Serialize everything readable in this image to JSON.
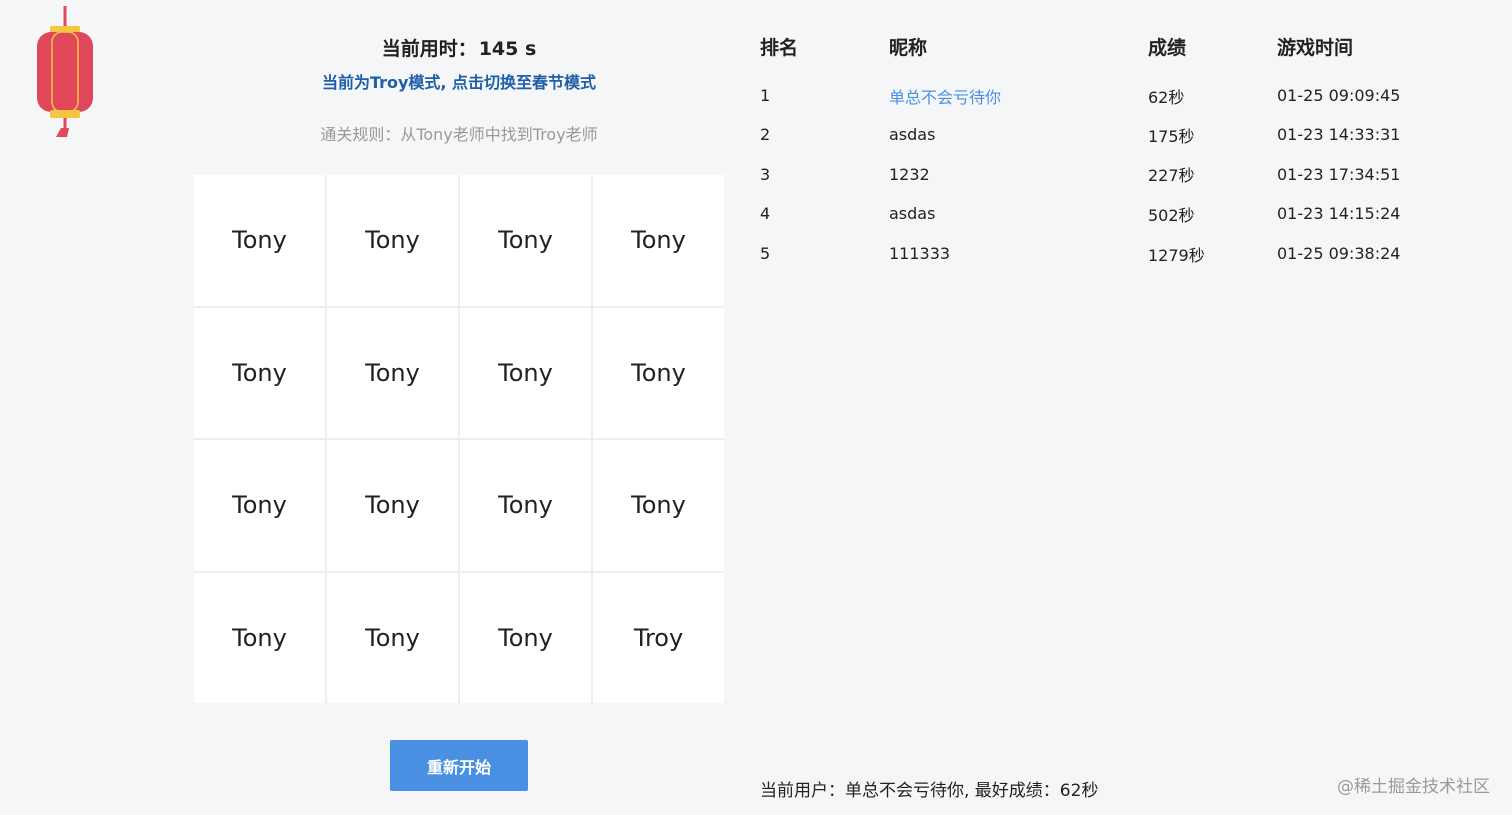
{
  "game": {
    "timer_label": "当前用时：",
    "timer_value": "145 s",
    "mode_switch": "当前为Troy模式, 点击切换至春节模式",
    "rules": "通关规则：从Tony老师中找到Troy老师",
    "cells": [
      "Tony",
      "Tony",
      "Tony",
      "Tony",
      "Tony",
      "Tony",
      "Tony",
      "Tony",
      "Tony",
      "Tony",
      "Tony",
      "Tony",
      "Tony",
      "Tony",
      "Tony",
      "Troy"
    ],
    "restart_label": "重新开始"
  },
  "leaderboard": {
    "headers": [
      "排名",
      "昵称",
      "成绩",
      "游戏时间"
    ],
    "rows": [
      {
        "rank": "1",
        "nickname": "单总不会亏待你",
        "score": "62秒",
        "time": "01-25 09:09:45"
      },
      {
        "rank": "2",
        "nickname": "asdas",
        "score": "175秒",
        "time": "01-23 14:33:31"
      },
      {
        "rank": "3",
        "nickname": "1232",
        "score": "227秒",
        "time": "01-23 17:34:51"
      },
      {
        "rank": "4",
        "nickname": "asdas",
        "score": "502秒",
        "time": "01-23 14:15:24"
      },
      {
        "rank": "5",
        "nickname": "111333",
        "score": "1279秒",
        "time": "01-25 09:38:24"
      }
    ]
  },
  "footer": {
    "current_user": "当前用户：单总不会亏待你, 最好成绩：62秒",
    "watermark": "@稀土掘金技术社区"
  },
  "colors": {
    "background": "#f5f6f8",
    "accent": "#4a90e2",
    "mode_link": "#1f5fa8",
    "lantern_red": "#e0475a",
    "lantern_gold": "#f4c542"
  },
  "icons": {
    "lantern": "lantern-icon"
  }
}
